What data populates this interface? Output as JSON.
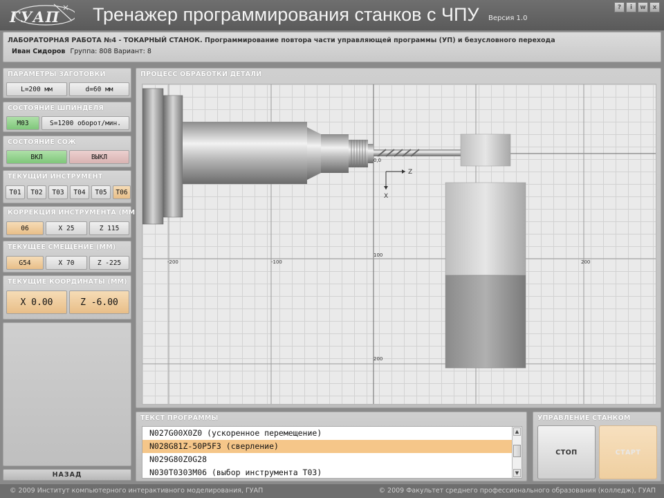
{
  "header": {
    "logo_text": "ГУАП",
    "title": "Тренажер программирования станков с ЧПУ",
    "version": "Версия 1.0",
    "window_buttons": [
      "?",
      "i",
      "w",
      "x"
    ]
  },
  "lab": {
    "title": "ЛАБОРАТОРНАЯ РАБОТА №4 - ТОКАРНЫЙ СТАНОК. Программирование повтора части управляющей программы (УП) и безусловного перехода",
    "student_name": "Иван Сидоров",
    "group": "Группа: 808",
    "variant": "Вариант: 8"
  },
  "blank": {
    "title": "ПАРАМЕТРЫ ЗАГОТОВКИ",
    "length": "L=200 мм",
    "diameter": "d=60 мм"
  },
  "spindle": {
    "title": "СОСТОЯНИЕ ШПИНДЕЛЯ",
    "code": "M03",
    "speed": "S=1200 оборот/мин."
  },
  "coolant": {
    "title": "СОСТОЯНИЕ СОЖ",
    "on": "ВКЛ",
    "off": "ВЫКЛ"
  },
  "tool": {
    "title": "ТЕКУЩИЙ ИНСТРУМЕНТ",
    "items": [
      "T01",
      "T02",
      "T03",
      "T04",
      "T05",
      "T06"
    ],
    "active_index": 5
  },
  "correction": {
    "title": "КОРРЕКЦИЯ ИНСТРУМЕНТА (ММ)",
    "num": "06",
    "x": "X 25",
    "z": "Z 115"
  },
  "offset": {
    "title": "ТЕКУЩЕЕ СМЕЩЕНИЕ (ММ)",
    "code": "G54",
    "x": "X 70",
    "z": "Z -225"
  },
  "coords": {
    "title": "ТЕКУЩИЕ КООРДИНАТЫ (ММ)",
    "x": "X 0.00",
    "z": "Z -6.00"
  },
  "back_label": "НАЗАД",
  "process": {
    "title": "ПРОЦЕСС ОБРАБОТКИ ДЕТАЛИ",
    "origin_label": "0,0",
    "axis_z": "Z",
    "axis_x": "X",
    "ticks_h": [
      "-200",
      "-100",
      "100",
      "200"
    ],
    "ticks_v": [
      "100",
      "200"
    ]
  },
  "program": {
    "title": "ТЕКСТ ПРОГРАММЫ",
    "lines": [
      "N027G00X0Z0 (ускоренное перемещение)",
      "N028G81Z-50P5F3 (сверление)",
      "N029G80Z0G28",
      "N030T0303M06 (выбор инструмента Т03)"
    ],
    "selected_index": 1
  },
  "control": {
    "title": "УПРАВЛЕНИЕ СТАНКОМ",
    "stop": "СТОП",
    "start": "СТАРТ"
  },
  "footer": {
    "left": "© 2009 Институт компьютерного интерактивного моделирования, ГУАП",
    "right": "© 2009 Факультет среднего профессионального образования (колледж), ГУАП"
  },
  "colors": {
    "accent_orange": "#f5c689",
    "coolant_on": "#7fc77a",
    "coolant_off": "#d9b3b2"
  }
}
